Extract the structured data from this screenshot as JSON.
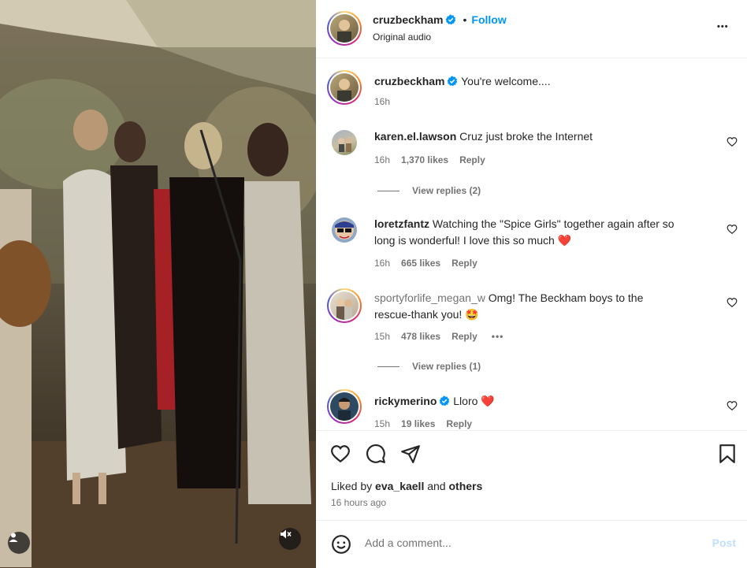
{
  "post": {
    "author": "cruzbeckham",
    "follow_label": "Follow",
    "separator": "•",
    "audio": "Original audio",
    "more_label": "•••"
  },
  "caption": {
    "author": "cruzbeckham",
    "text": "You're welcome....",
    "time": "16h"
  },
  "comments": [
    {
      "user": "karen.el.lawson",
      "text": "Cruz just broke the Internet",
      "time": "16h",
      "likes": "1,370 likes",
      "reply": "Reply",
      "view_replies": "View replies (2)"
    },
    {
      "user": "loretzfantz",
      "text_line1": "Watching the \"Spice Girls\" together again after so",
      "text_line2": "long is wonderful! I love this so much",
      "emoji": "❤️",
      "time": "16h",
      "likes": "665 likes",
      "reply": "Reply"
    },
    {
      "user": "sportyforlife_megan_w",
      "text_line1": "Omg! The Beckham boys to the",
      "text_line2": "rescue-thank you!",
      "emoji": "🤩",
      "time": "15h",
      "likes": "478 likes",
      "reply": "Reply",
      "more": "•••",
      "view_replies": "View replies (1)"
    },
    {
      "user": "rickymerino",
      "text": "Lloro",
      "emoji": "❤️",
      "time": "15h",
      "likes": "19 likes",
      "reply": "Reply"
    }
  ],
  "likes": {
    "prefix": "Liked by",
    "user": "eva_kaell",
    "middle": "and",
    "others": "others",
    "time_ago": "16 hours ago"
  },
  "add_comment": {
    "placeholder": "Add a comment...",
    "post_label": "Post"
  },
  "icons": {
    "like": "heart-icon",
    "comment": "comment-icon",
    "share": "send-icon",
    "save": "bookmark-icon",
    "emoji": "emoji-icon",
    "tag": "user-tag-icon",
    "mute": "speaker-muted-icon",
    "verified": "verified-badge-icon"
  },
  "colors": {
    "accent": "#0095f6",
    "text": "#262626",
    "secondary": "#737373",
    "heart_red": "#ff3040",
    "post_disabled": "#c0dffd"
  }
}
